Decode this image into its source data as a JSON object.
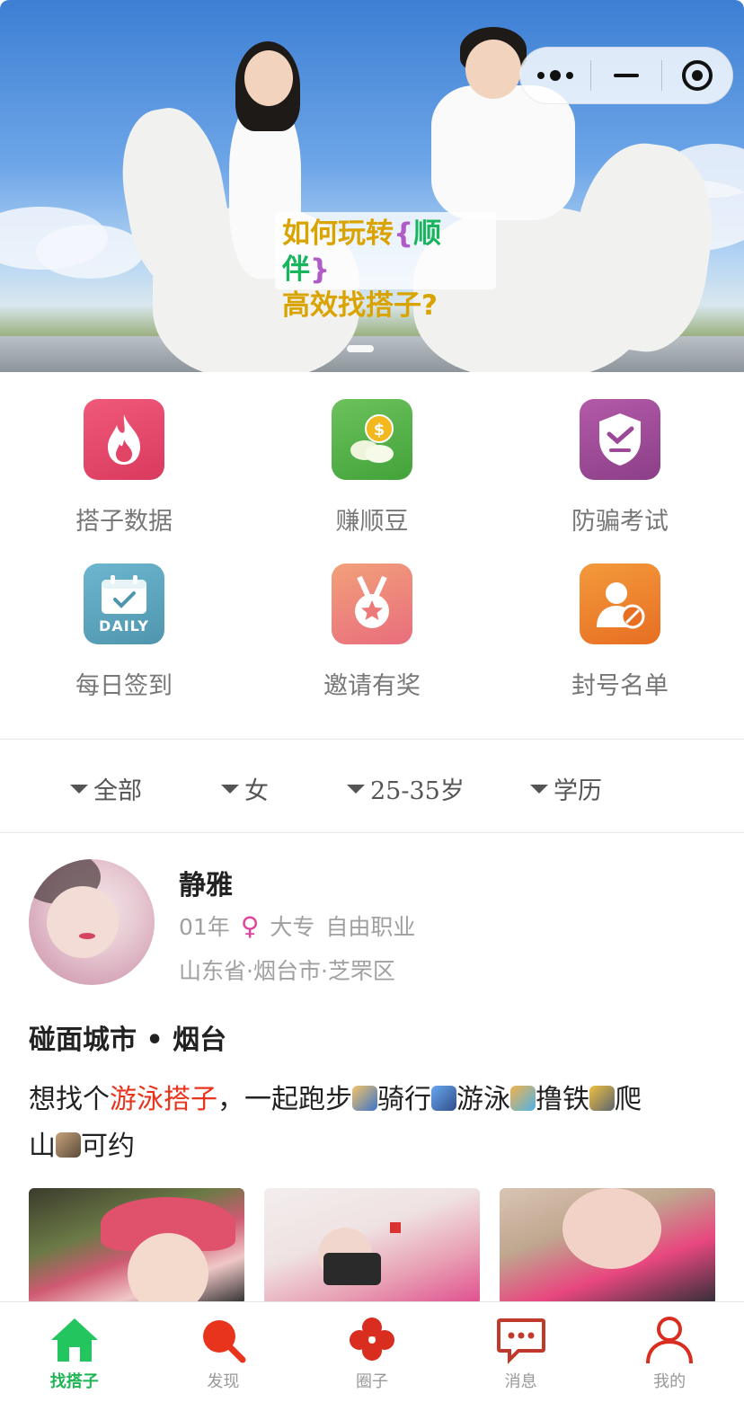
{
  "banner": {
    "caption_line1_prefix": "如何玩转",
    "caption_brace_open": "{",
    "caption_highlight": "顺伴",
    "caption_brace_close": "}",
    "caption_line2": "高效找搭子?"
  },
  "grid": {
    "items": [
      {
        "label": "搭子数据",
        "icon": "flame-icon",
        "color": "#e8456a"
      },
      {
        "label": "赚顺豆",
        "icon": "coin-beans-icon",
        "color": "#58b34c"
      },
      {
        "label": "防骗考试",
        "icon": "shield-check-icon",
        "color": "#a04a9a"
      },
      {
        "label": "每日签到",
        "icon": "daily-calendar-icon",
        "color": "#5aa5c0",
        "badge": "DAILY"
      },
      {
        "label": "邀请有奖",
        "icon": "medal-icon",
        "color": "#ee8878"
      },
      {
        "label": "封号名单",
        "icon": "banned-user-icon",
        "color": "#ee7d2e"
      }
    ]
  },
  "filters": [
    {
      "label": "全部"
    },
    {
      "label": "女"
    },
    {
      "label": "25-35岁"
    },
    {
      "label": "学历"
    }
  ],
  "card": {
    "name": "静雅",
    "year": "01年",
    "gender_symbol": "♀",
    "education": "大专",
    "job": "自由职业",
    "location": "山东省·烟台市·芝罘区",
    "city_line": "碰面城市 • 烟台",
    "post_prefix": "想找个",
    "post_highlight": "游泳搭子",
    "post_run": "，一起跑步",
    "post_ride": "骑行",
    "post_swim": "游泳",
    "post_lift": "撸铁",
    "post_climb_1": "爬",
    "post_climb_2": "山",
    "post_end": "可约"
  },
  "tabbar": {
    "tabs": [
      {
        "label": "找搭子",
        "icon": "home-icon",
        "active": true
      },
      {
        "label": "发现",
        "icon": "search-icon",
        "active": false
      },
      {
        "label": "圈子",
        "icon": "clover-icon",
        "active": false
      },
      {
        "label": "消息",
        "icon": "chat-icon",
        "active": false
      },
      {
        "label": "我的",
        "icon": "user-icon",
        "active": false
      }
    ]
  }
}
